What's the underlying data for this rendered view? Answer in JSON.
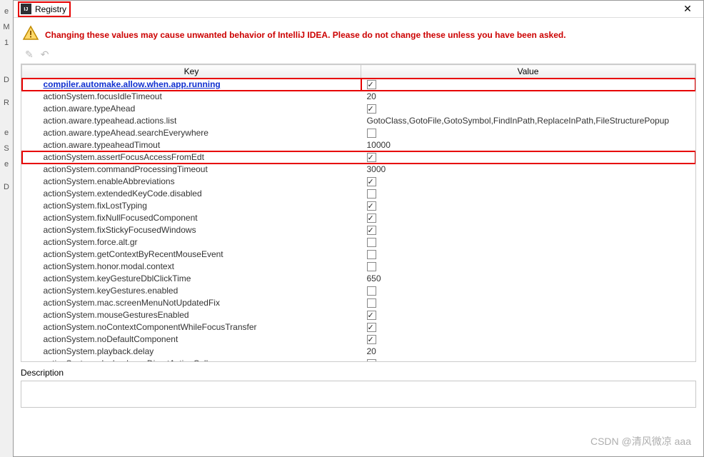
{
  "window": {
    "title": "Registry",
    "close": "✕"
  },
  "warning": "Changing these values may cause unwanted behavior of IntelliJ IDEA. Please do not change these unless you have been asked.",
  "columns": {
    "key": "Key",
    "value": "Value"
  },
  "rows": [
    {
      "key": "compiler.automake.allow.when.app.running",
      "type": "check",
      "value": true,
      "highlight": true,
      "link": true
    },
    {
      "key": "actionSystem.focusIdleTimeout",
      "type": "text",
      "value": "20"
    },
    {
      "key": "action.aware.typeAhead",
      "type": "check",
      "value": true
    },
    {
      "key": "action.aware.typeahead.actions.list",
      "type": "text",
      "value": "GotoClass,GotoFile,GotoSymbol,FindInPath,ReplaceInPath,FileStructurePopup"
    },
    {
      "key": "action.aware.typeAhead.searchEverywhere",
      "type": "check",
      "value": false
    },
    {
      "key": "action.aware.typeaheadTimout",
      "type": "text",
      "value": "10000"
    },
    {
      "key": "actionSystem.assertFocusAccessFromEdt",
      "type": "check",
      "value": true,
      "highlight": true
    },
    {
      "key": "actionSystem.commandProcessingTimeout",
      "type": "text",
      "value": "3000"
    },
    {
      "key": "actionSystem.enableAbbreviations",
      "type": "check",
      "value": true
    },
    {
      "key": "actionSystem.extendedKeyCode.disabled",
      "type": "check",
      "value": false
    },
    {
      "key": "actionSystem.fixLostTyping",
      "type": "check",
      "value": true
    },
    {
      "key": "actionSystem.fixNullFocusedComponent",
      "type": "check",
      "value": true
    },
    {
      "key": "actionSystem.fixStickyFocusedWindows",
      "type": "check",
      "value": true
    },
    {
      "key": "actionSystem.force.alt.gr",
      "type": "check",
      "value": false
    },
    {
      "key": "actionSystem.getContextByRecentMouseEvent",
      "type": "check",
      "value": false
    },
    {
      "key": "actionSystem.honor.modal.context",
      "type": "check",
      "value": false
    },
    {
      "key": "actionSystem.keyGestureDblClickTime",
      "type": "text",
      "value": "650"
    },
    {
      "key": "actionSystem.keyGestures.enabled",
      "type": "check",
      "value": false
    },
    {
      "key": "actionSystem.mac.screenMenuNotUpdatedFix",
      "type": "check",
      "value": false
    },
    {
      "key": "actionSystem.mouseGesturesEnabled",
      "type": "check",
      "value": true
    },
    {
      "key": "actionSystem.noContextComponentWhileFocusTransfer",
      "type": "check",
      "value": true
    },
    {
      "key": "actionSystem.noDefaultComponent",
      "type": "check",
      "value": true
    },
    {
      "key": "actionSystem.playback.delay",
      "type": "text",
      "value": "20"
    },
    {
      "key": "actionSystem.playback.useDirectActionCall",
      "type": "check",
      "value": true
    }
  ],
  "description_label": "Description",
  "gutter": [
    "e",
    "M",
    "1",
    "",
    "",
    "",
    "D",
    "",
    "R",
    "",
    "",
    "e",
    "S",
    "e",
    "",
    "D"
  ],
  "watermark": "CSDN @清风微凉 aaa"
}
